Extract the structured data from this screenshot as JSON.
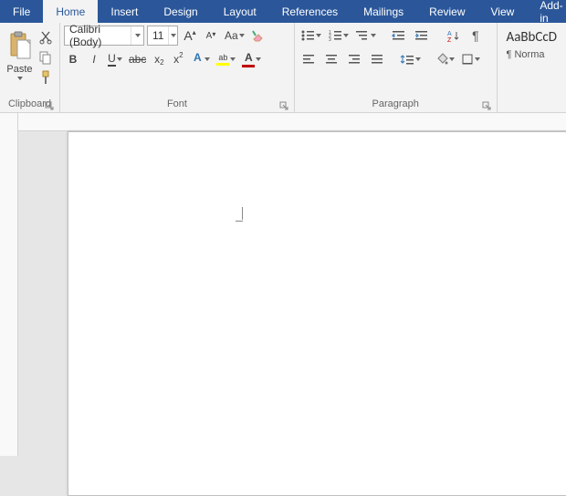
{
  "tabs": {
    "file": "File",
    "home": "Home",
    "insert": "Insert",
    "design": "Design",
    "layout": "Layout",
    "references": "References",
    "mailings": "Mailings",
    "review": "Review",
    "view": "View",
    "addins": "Add-in"
  },
  "clipboard": {
    "paste": "Paste",
    "label": "Clipboard"
  },
  "font": {
    "name": "Calibri (Body)",
    "size": "11",
    "grow": "A",
    "shrink": "A",
    "case": "Aa",
    "bold": "B",
    "italic": "I",
    "underline": "U",
    "strike": "abc",
    "sub": "x",
    "sup": "x",
    "fontcolor_A": "A",
    "highlight_ab": "ab",
    "textfx_A": "A",
    "label": "Font",
    "colors": {
      "fontcolor": "#c00000",
      "highlight": "#ffff00",
      "textfx_underline": "#2e75b6"
    }
  },
  "paragraph": {
    "label": "Paragraph"
  },
  "styles": {
    "preview": "AaBbCcD",
    "name": "¶ Norma"
  }
}
